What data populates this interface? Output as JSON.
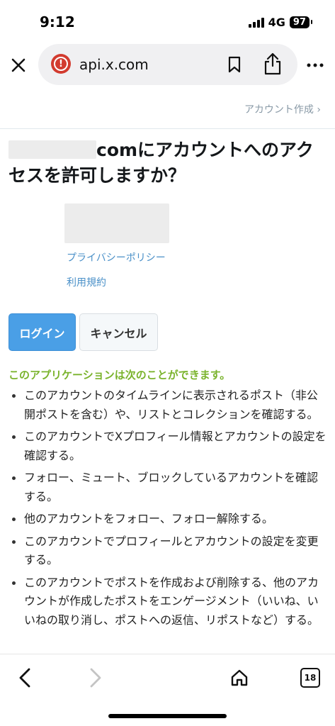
{
  "status_bar": {
    "time": "9:12",
    "network": "4G",
    "battery": "97"
  },
  "browser": {
    "url": "api.x.com",
    "tab_count": "18"
  },
  "header": {
    "signup_link": "アカウント作成 ›"
  },
  "auth": {
    "title_suffix": "comにアカウントへのアクセスを許可しますか？",
    "privacy_link": "プライバシーポリシー",
    "terms_link": "利用規約",
    "login_label": "ログイン",
    "cancel_label": "キャンセル"
  },
  "permissions": {
    "heading": "このアプリケーションは次のことができます。",
    "items": [
      "このアカウントのタイムラインに表示されるポスト（非公開ポストを含む）や、リストとコレクションを確認する。",
      "このアカウントでXプロフィール情報とアカウントの設定を確認する。",
      "フォロー、ミュート、ブロックしているアカウントを確認する。",
      "他のアカウントをフォロー、フォロー解除する。",
      "このアカウントでプロフィールとアカウントの設定を変更する。",
      "このアカウントでポストを作成および削除する、他のアカウントが作成したポストをエンゲージメント（いいね、いいねの取り消し、ポストへの返信、リポストなど）する。"
    ]
  },
  "icons": {
    "close": "close-icon",
    "site": "warning-icon",
    "bookmark": "bookmark-icon",
    "share": "share-icon",
    "more": "more-icon",
    "back": "chevron-left-icon",
    "forward": "chevron-right-icon",
    "home": "home-icon",
    "tabs": "tabs-icon"
  },
  "colors": {
    "primary": "#4a9fe6",
    "link": "#4a90c8",
    "permission_heading": "#7ab32c",
    "site_warning": "#d23b2f"
  }
}
